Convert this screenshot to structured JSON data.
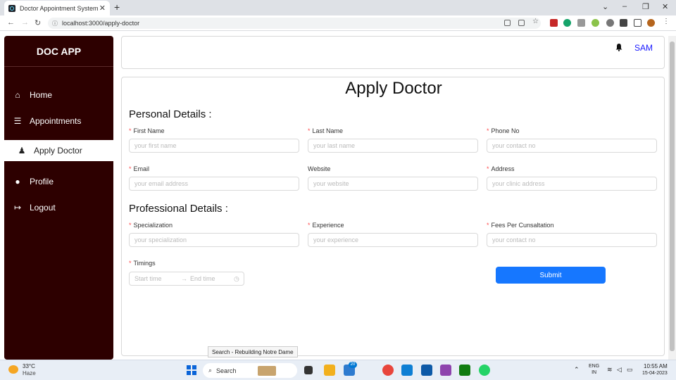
{
  "browser": {
    "tab_title": "Doctor Appointment System",
    "tab_close": "✕",
    "new_tab": "+",
    "url": "localhost:3000/apply-doctor",
    "minimize": "⌄",
    "min_btn": "–",
    "max_btn": "❐",
    "close_btn": "✕"
  },
  "sidebar": {
    "logo": "DOC APP",
    "items": [
      {
        "label": "Home",
        "icon": "home-icon",
        "glyph": "⌂"
      },
      {
        "label": "Appointments",
        "icon": "list-icon",
        "glyph": "☰"
      },
      {
        "label": "Apply Doctor",
        "icon": "user-doctor-icon",
        "glyph": "♟"
      },
      {
        "label": "Profile",
        "icon": "user-icon",
        "glyph": "●"
      },
      {
        "label": "Logout",
        "icon": "logout-icon",
        "glyph": "↦"
      }
    ]
  },
  "header": {
    "bell_glyph": "🔔",
    "username": "SAM"
  },
  "form": {
    "title": "Apply Doctor",
    "personal_title": "Personal Details :",
    "professional_title": "Professional Details :",
    "fields": {
      "first_name": {
        "label": "First Name",
        "placeholder": "your first name",
        "required": true
      },
      "last_name": {
        "label": "Last Name",
        "placeholder": "your last name",
        "required": true
      },
      "phone": {
        "label": "Phone No",
        "placeholder": "your contact no",
        "required": true
      },
      "email": {
        "label": "Email",
        "placeholder": "your email address",
        "required": true
      },
      "website": {
        "label": "Website",
        "placeholder": "your website",
        "required": false
      },
      "address": {
        "label": "Address",
        "placeholder": "your clinic address",
        "required": true
      },
      "specialization": {
        "label": "Specialization",
        "placeholder": "your specialization",
        "required": true
      },
      "experience": {
        "label": "Experience",
        "placeholder": "your experience",
        "required": true
      },
      "fees": {
        "label": "Fees Per Cunsaltation",
        "placeholder": "your contact no",
        "required": true
      },
      "timings": {
        "label": "Timings",
        "start_placeholder": "Start time",
        "end_placeholder": "End time",
        "required": true
      }
    },
    "required_mark": "*",
    "submit_label": "Submit"
  },
  "tooltip": "Search - Rebuilding Notre Dame",
  "taskbar": {
    "temperature": "33°C",
    "weather": "Haze",
    "search_label": "Search",
    "badge": "20",
    "lang_line1": "ENG",
    "lang_line2": "IN",
    "time": "10:55 AM",
    "date": "15-04-2023"
  },
  "colors": {
    "sidebar_bg": "#2d0000",
    "accent": "#1677ff",
    "username": "#1a1aff",
    "required": "#ff4d4f"
  }
}
